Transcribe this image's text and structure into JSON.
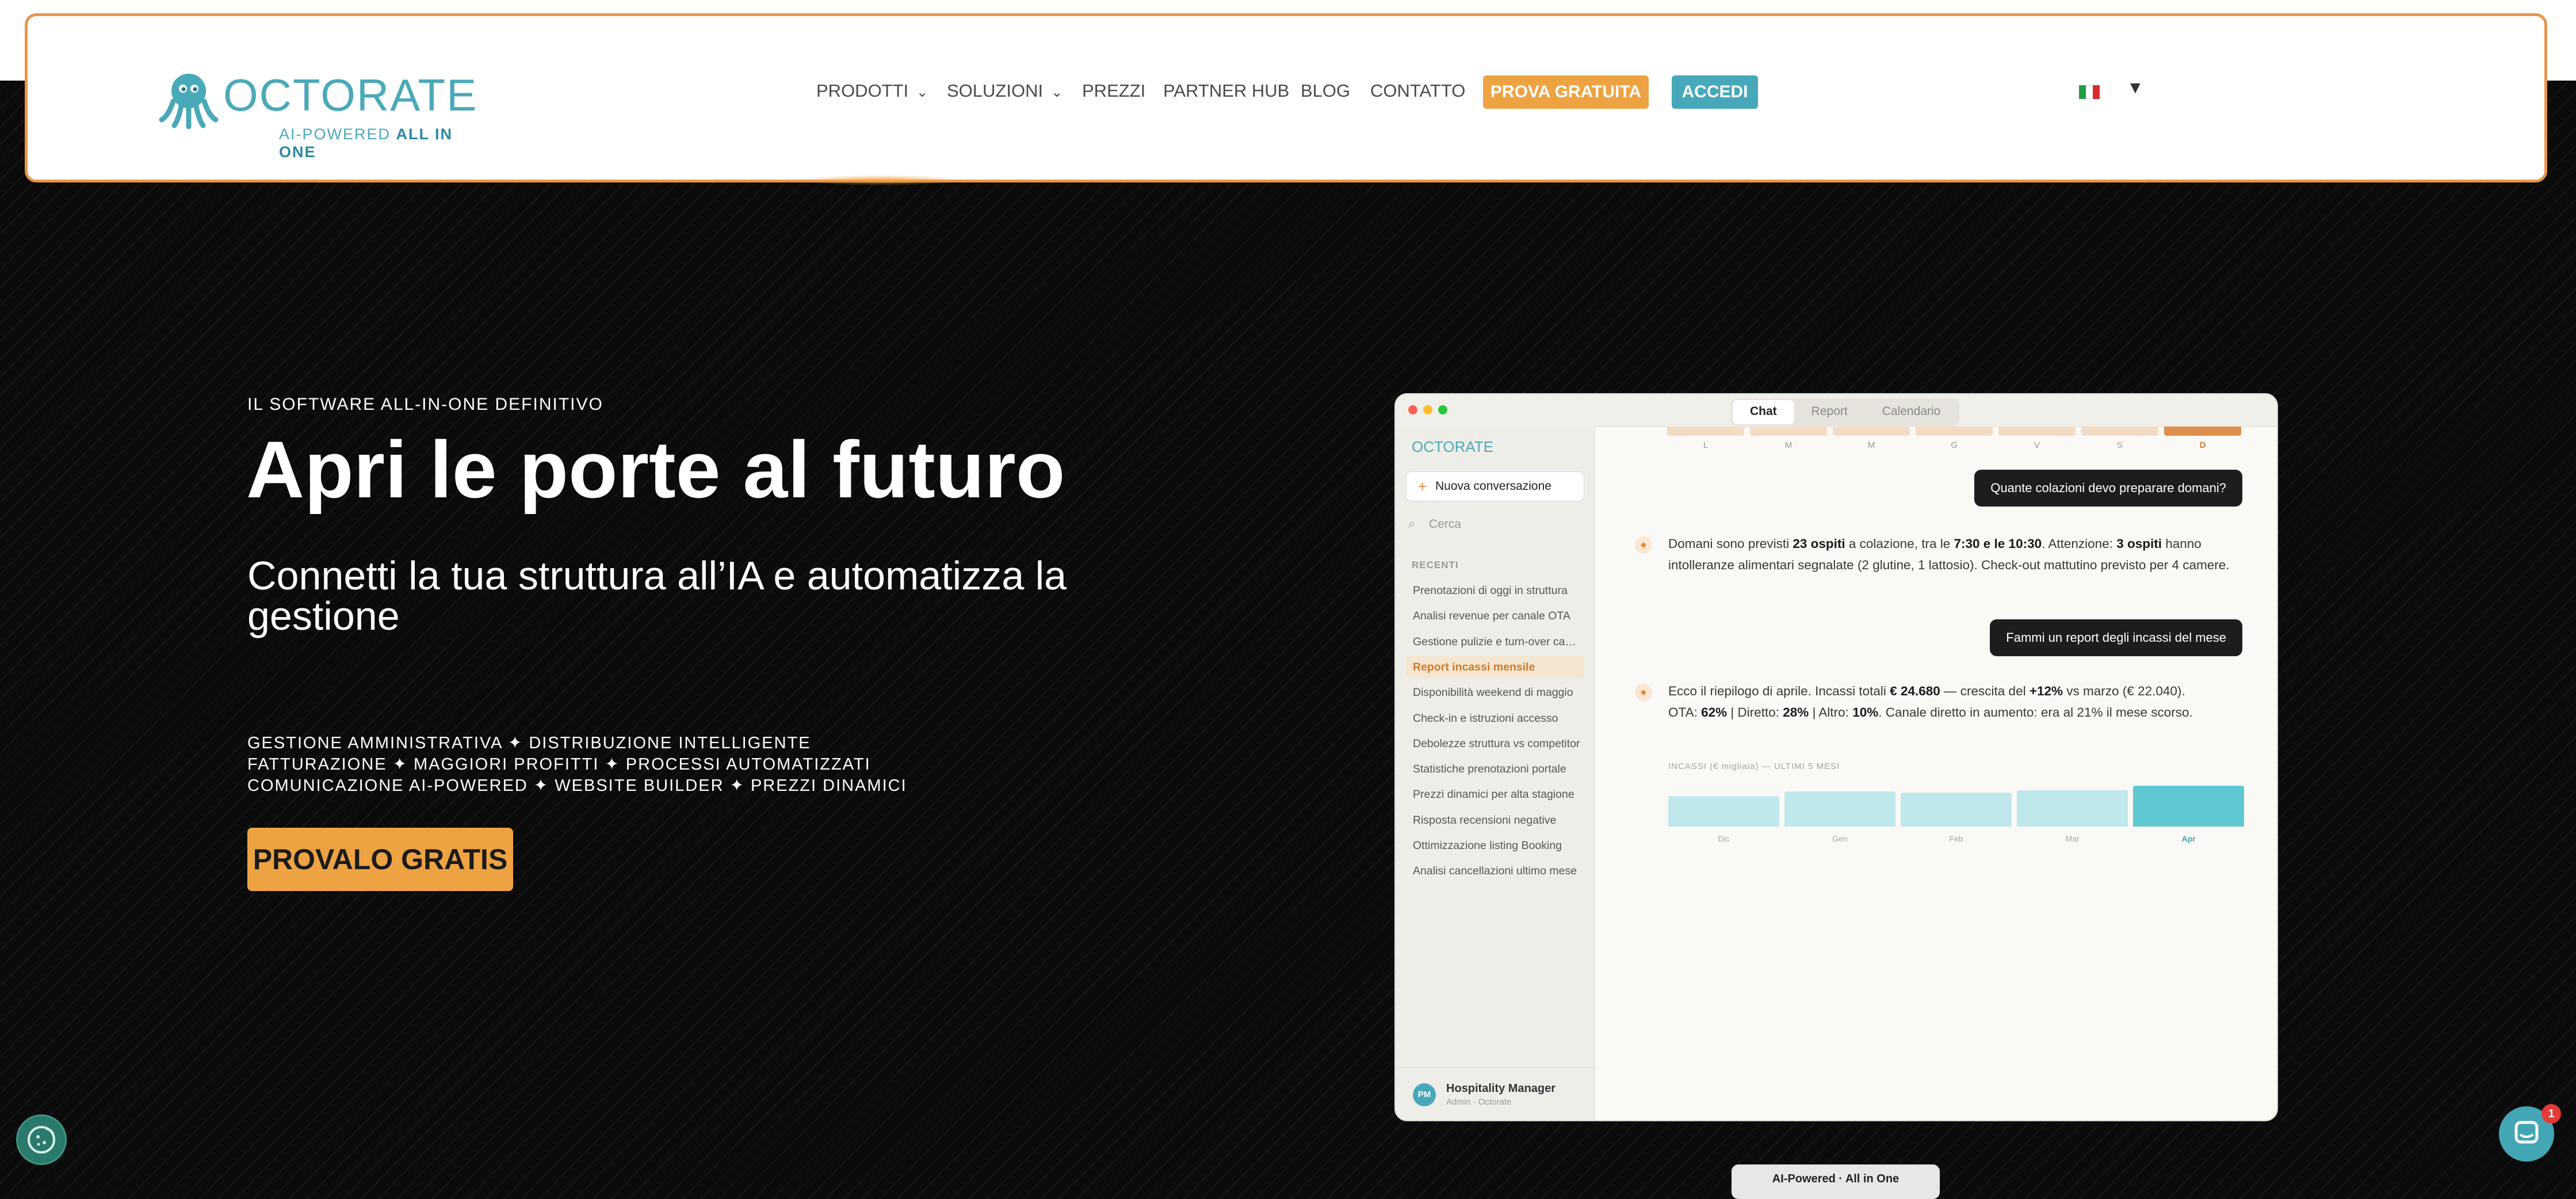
{
  "brand": {
    "name": "OCTORATE",
    "tagline_a": "AI-POWERED",
    "tagline_b": "ALL IN ONE",
    "color_primary": "#47a8ba",
    "color_accent": "#eea343"
  },
  "nav": {
    "items": [
      {
        "label": "PRODOTTI",
        "has_dropdown": true
      },
      {
        "label": "SOLUZIONI",
        "has_dropdown": true
      },
      {
        "label": "PREZZI"
      },
      {
        "label": "PARTNER HUB"
      },
      {
        "label": "BLOG"
      },
      {
        "label": "CONTATTO"
      }
    ],
    "trial_label": "PROVA GRATUITA",
    "login_label": "ACCEDI",
    "language_icon": "italian-flag-icon"
  },
  "hero": {
    "eyebrow": "IL SOFTWARE ALL-IN-ONE DEFINITIVO",
    "title": "Apri le porte al futuro",
    "subtitle": "Connetti la tua struttura all’IA e automatizza la gestione",
    "features": [
      "GESTIONE AMMINISTRATIVA ✦ DISTRIBUZIONE INTELLIGENTE",
      "FATTURAZIONE ✦ MAGGIORI PROFITTI ✦ PROCESSI AUTOMATIZZATI",
      "COMUNICAZIONE AI-POWERED ✦ WEBSITE BUILDER ✦ PREZZI DINAMICI"
    ],
    "cta_label": "PROVALO GRATIS"
  },
  "app": {
    "tabs": [
      "Chat",
      "Report",
      "Calendario"
    ],
    "active_tab": "Chat",
    "sidebar": {
      "logo": "OCTORATE",
      "new_conversation": "Nuova conversazione",
      "search_placeholder": "Cerca",
      "section_label": "RECENTI",
      "items": [
        "Prenotazioni di oggi in struttura",
        "Analisi revenue per canale OTA",
        "Gestione pulizie e turn-over camere",
        "Report incassi mensile",
        "Disponibilità weekend di maggio",
        "Check-in e istruzioni accesso",
        "Debolezze struttura vs competitor",
        "Statistiche prenotazioni portale",
        "Prezzi dinamici per alta stagione",
        "Risposta recensioni negative",
        "Ottimizzazione listing Booking",
        "Analisi cancellazioni ultimo mese"
      ],
      "active_index": 3,
      "user_initials": "PM",
      "user_name": "Hospitality Manager",
      "user_role": "Admin · Octorate"
    },
    "chat": {
      "day_labels": [
        "L",
        "M",
        "M",
        "G",
        "V",
        "S",
        "D"
      ],
      "today_index": 6,
      "q1": "Quante colazioni devo preparare domani?",
      "a1_html": "Domani sono previsti <b>23 ospiti</b> a colazione, tra le <b>7:30 e le 10:30</b>. Attenzione: <b>3 ospiti</b> hanno intolleranze alimentari segnalate (2 glutine, 1 lattosio). Check-out mattutino previsto per 4 camere.",
      "q2": "Fammi un report degli incassi del mese",
      "a2_html": "Ecco il riepilogo di aprile. Incassi totali <b>€ 24.680</b> — crescita del <b>+12%</b> vs marzo (€ 22.040).<br>OTA: <b>62%</b> | Diretto: <b>28%</b> | Altro: <b>10%</b>. Canale diretto in aumento: era al 21% il mese scorso.",
      "mini_chart_title": "INCASSI (€ migliaia) — ULTIMI 5 MESI"
    }
  },
  "chart_data": {
    "type": "bar",
    "categories": [
      "Dic",
      "Gen",
      "Feb",
      "Mar",
      "Apr"
    ],
    "values": [
      18.5,
      21.3,
      20.4,
      22.0,
      24.7
    ],
    "title": "INCASSI (€ migliaia) — ULTIMI 5 MESI",
    "highlight": "Apr",
    "ylim": [
      0,
      25
    ]
  },
  "footer_pill": "AI-Powered · All in One",
  "chat_badge": "1"
}
